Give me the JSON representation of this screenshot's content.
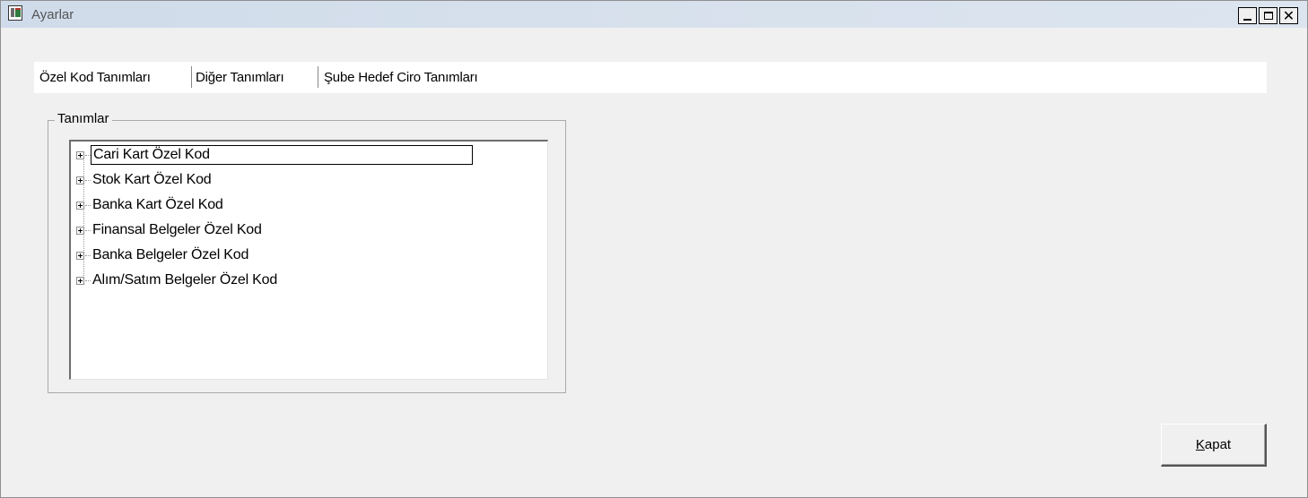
{
  "window": {
    "title": "Ayarlar"
  },
  "title_controls": {
    "minimize": "minimize-icon",
    "maximize": "maximize-icon",
    "close": "close-icon"
  },
  "tabs": [
    {
      "label": "Özel Kod Tanımları",
      "active": true
    },
    {
      "label": "Diğer Tanımları",
      "active": false
    },
    {
      "label": "Şube Hedef Ciro Tanımları",
      "active": false
    }
  ],
  "group": {
    "title": "Tanımlar"
  },
  "tree": {
    "items": [
      {
        "label": "Cari Kart Özel Kod",
        "selected": true,
        "expandable": true
      },
      {
        "label": "Stok Kart Özel Kod",
        "selected": false,
        "expandable": true
      },
      {
        "label": "Banka Kart Özel Kod",
        "selected": false,
        "expandable": true
      },
      {
        "label": "Finansal Belgeler Özel Kod",
        "selected": false,
        "expandable": true
      },
      {
        "label": "Banka Belgeler Özel Kod",
        "selected": false,
        "expandable": true
      },
      {
        "label": "Alım/Satım Belgeler Özel Kod",
        "selected": false,
        "expandable": true
      }
    ]
  },
  "buttons": {
    "close_accel": "K",
    "close_rest": "apat"
  }
}
